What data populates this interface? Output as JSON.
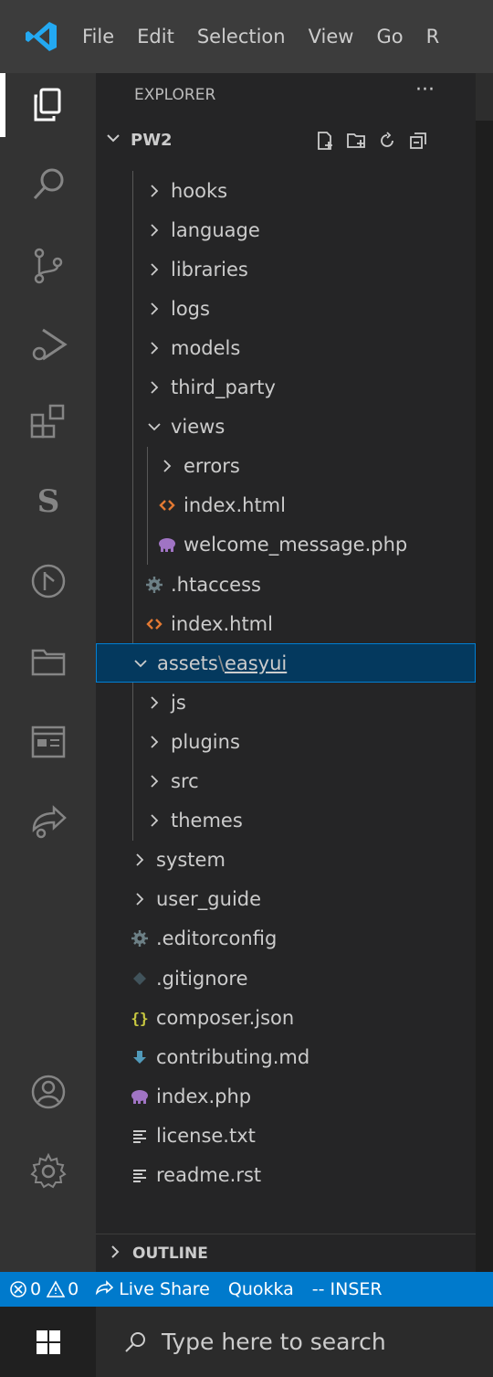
{
  "menu": [
    "File",
    "Edit",
    "Selection",
    "View",
    "Go",
    "R"
  ],
  "activity_icons": [
    "explorer-icon",
    "search-icon",
    "source-control-icon",
    "run-debug-icon",
    "extensions-icon",
    "s-extension-icon",
    "timeline-icon",
    "folder-icon",
    "browser-preview-icon",
    "live-share-icon"
  ],
  "explorer": {
    "title": "EXPLORER",
    "more": "···"
  },
  "workspace": {
    "name": "PW2"
  },
  "tree": [
    {
      "label": "hooks",
      "indent": 2,
      "kind": "folder",
      "open": false
    },
    {
      "label": "language",
      "indent": 2,
      "kind": "folder",
      "open": false
    },
    {
      "label": "libraries",
      "indent": 2,
      "kind": "folder",
      "open": false
    },
    {
      "label": "logs",
      "indent": 2,
      "kind": "folder",
      "open": false
    },
    {
      "label": "models",
      "indent": 2,
      "kind": "folder",
      "open": false
    },
    {
      "label": "third_party",
      "indent": 2,
      "kind": "folder",
      "open": false
    },
    {
      "label": "views",
      "indent": 2,
      "kind": "folder",
      "open": true
    },
    {
      "label": "errors",
      "indent": 3,
      "kind": "folder",
      "open": false
    },
    {
      "label": "index.html",
      "indent": 3,
      "kind": "html"
    },
    {
      "label": "welcome_message.php",
      "indent": 3,
      "kind": "php"
    },
    {
      "label": ".htaccess",
      "indent": 2,
      "kind": "config"
    },
    {
      "label": "index.html",
      "indent": 2,
      "kind": "html"
    },
    {
      "label": "assets",
      "indent": 1,
      "kind": "folder",
      "open": true,
      "selected": true,
      "suffix": "easyui"
    },
    {
      "label": "js",
      "indent": 2,
      "kind": "folder",
      "open": false
    },
    {
      "label": "plugins",
      "indent": 2,
      "kind": "folder",
      "open": false
    },
    {
      "label": "src",
      "indent": 2,
      "kind": "folder",
      "open": false
    },
    {
      "label": "themes",
      "indent": 2,
      "kind": "folder",
      "open": false
    },
    {
      "label": "system",
      "indent": 1,
      "kind": "folder",
      "open": false
    },
    {
      "label": "user_guide",
      "indent": 1,
      "kind": "folder",
      "open": false
    },
    {
      "label": ".editorconfig",
      "indent": 1,
      "kind": "config"
    },
    {
      "label": ".gitignore",
      "indent": 1,
      "kind": "git"
    },
    {
      "label": "composer.json",
      "indent": 1,
      "kind": "json"
    },
    {
      "label": "contributing.md",
      "indent": 1,
      "kind": "md"
    },
    {
      "label": "index.php",
      "indent": 1,
      "kind": "php"
    },
    {
      "label": "license.txt",
      "indent": 1,
      "kind": "txt"
    },
    {
      "label": "readme.rst",
      "indent": 1,
      "kind": "txt"
    }
  ],
  "outline": {
    "label": "OUTLINE"
  },
  "status": {
    "errors": "0",
    "warnings": "0",
    "live_share": "Live Share",
    "quokka": "Quokka",
    "mode": "-- INSER"
  },
  "taskbar": {
    "search_placeholder": "Type here to search"
  },
  "colors": {
    "accent": "#007acc",
    "html": "#e37933",
    "php": "#a074c4",
    "json": "#cbcb41",
    "md": "#519aba",
    "config": "#6d8086",
    "git": "#41535b",
    "selection": "#04395e"
  }
}
